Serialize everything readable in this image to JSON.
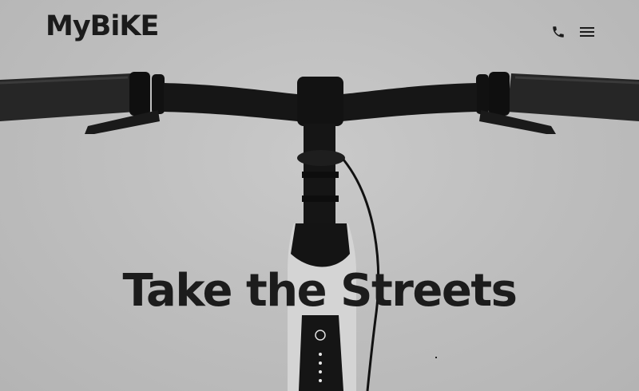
{
  "header": {
    "logo": "MyBiKE",
    "phone_icon": "phone-icon",
    "menu_icon": "hamburger-menu-icon"
  },
  "hero": {
    "headline": "Take the Streets",
    "image": "bicycle-handlebar-front-view"
  },
  "colors": {
    "background": "#bdbdbd",
    "text": "#1c1c1c",
    "bike_black": "#151515",
    "bike_frame_white": "#d6d6d6"
  }
}
